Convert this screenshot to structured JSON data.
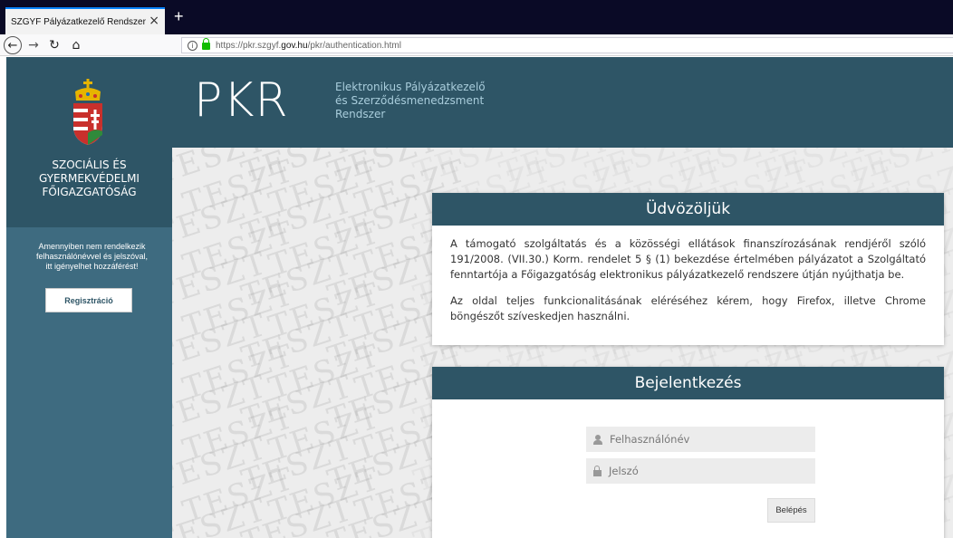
{
  "browser": {
    "tab_title": "SZGYF Pályázatkezelő Rendszer - Bej",
    "tab_close": "×",
    "new_tab": "+",
    "url_scheme": "https://pkr.szgyf.",
    "url_domain": "gov.hu",
    "url_path": "/pkr/authentication.html"
  },
  "sidebar": {
    "org_line1": "SZOCIÁLIS ÉS",
    "org_line2": "GYERMEKVÉDELMI",
    "org_line3": "FŐIGAZGATÓSÁG",
    "register_text_1": "Amennyiben nem rendelkezik",
    "register_text_2": "felhasználónévvel és jelszóval,",
    "register_text_3": "itt igényelhet hozzáférést!",
    "register_button": "Regisztráció"
  },
  "header": {
    "logo": "PKR",
    "subtitle_1": "Elektronikus Pályázatkezelő",
    "subtitle_2": "és Szerződésmenedzsment",
    "subtitle_3": "Rendszer"
  },
  "watermark_text": "TESZT",
  "welcome": {
    "title": "Üdvözöljük",
    "paragraph_1": "A támogató szolgáltatás és a közösségi ellátások finanszírozásának rendjéről szóló 191/2008. (VII.30.) Korm. rendelet 5 § (1) bekezdése értelmében pályázatot a Szolgáltató fenntartója a Főigazgatóság elektronikus pályázatkezelő rendszere útján nyújthatja be.",
    "paragraph_2": "Az oldal teljes funkcionalitásának eléréséhez kérem, hogy Firefox, illetve Chrome böngészőt szíveskedjen használni."
  },
  "login": {
    "title": "Bejelentkezés",
    "username_placeholder": "Felhasználónév",
    "password_placeholder": "Jelszó",
    "submit": "Belépés"
  },
  "colors": {
    "header_dark": "#2e5566",
    "sidebar": "#3e6b80",
    "subtitle": "#a9cddc",
    "lock_green": "#12bc00"
  }
}
